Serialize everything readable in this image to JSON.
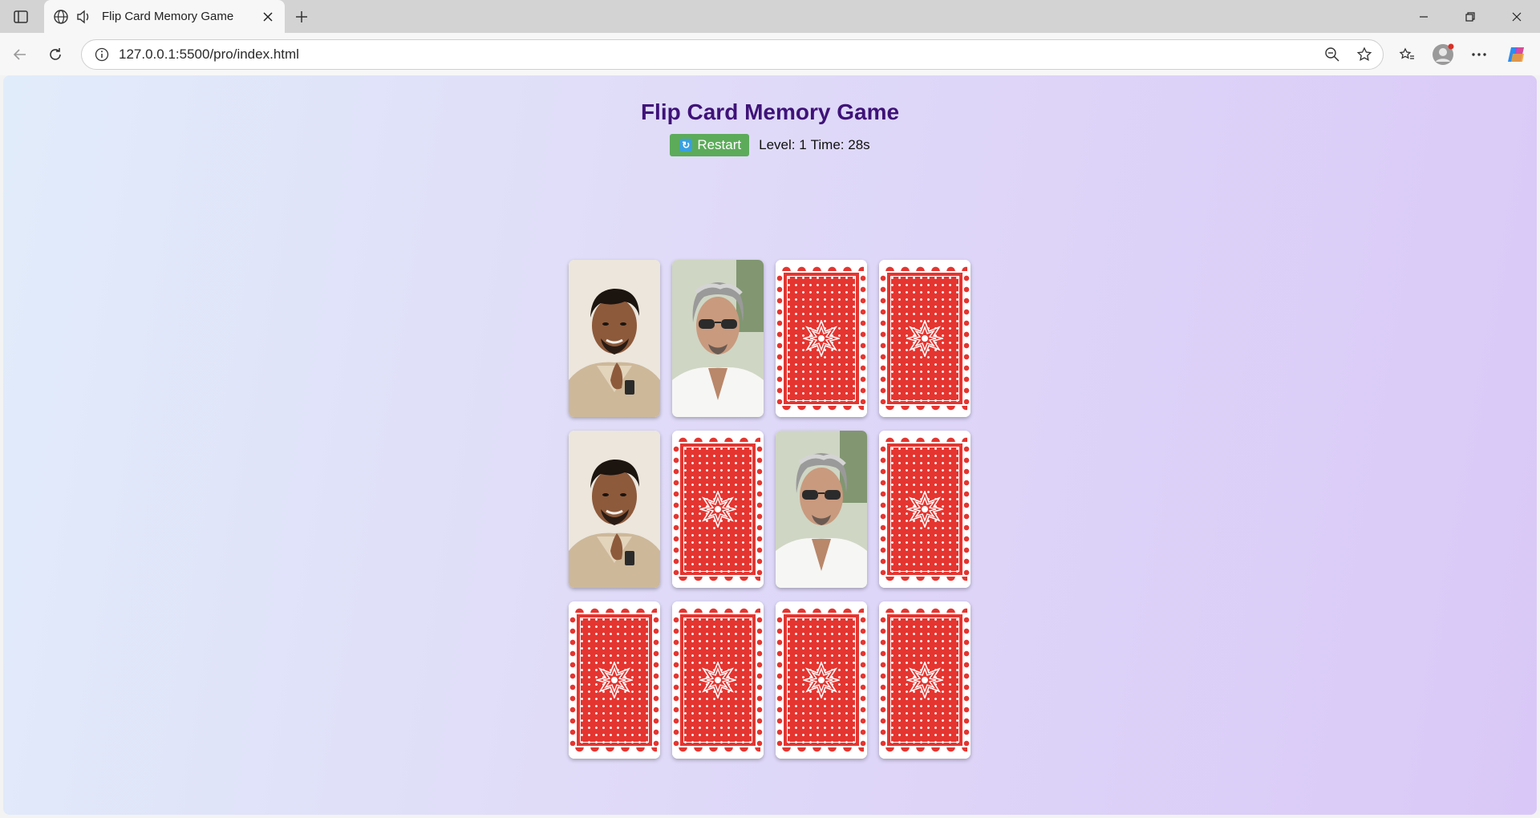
{
  "browser": {
    "tab_title": "Flip Card Memory Game",
    "url": "127.0.0.1:5500/pro/index.html"
  },
  "game": {
    "title": "Flip Card Memory Game",
    "restart_label": "Restart",
    "level_text": "Level: 1",
    "time_text": "Time: 28s"
  },
  "colors": {
    "card_back_red": "#e53530",
    "title_purple": "#3f1278",
    "restart_green": "#5cab5a"
  },
  "cards": [
    {
      "state": "face-up",
      "face": "portrait-a"
    },
    {
      "state": "face-up",
      "face": "portrait-b"
    },
    {
      "state": "face-down"
    },
    {
      "state": "face-down"
    },
    {
      "state": "face-up",
      "face": "portrait-a"
    },
    {
      "state": "face-down"
    },
    {
      "state": "face-up",
      "face": "portrait-b"
    },
    {
      "state": "face-down"
    },
    {
      "state": "face-down"
    },
    {
      "state": "face-down"
    },
    {
      "state": "face-down"
    },
    {
      "state": "face-down"
    }
  ]
}
